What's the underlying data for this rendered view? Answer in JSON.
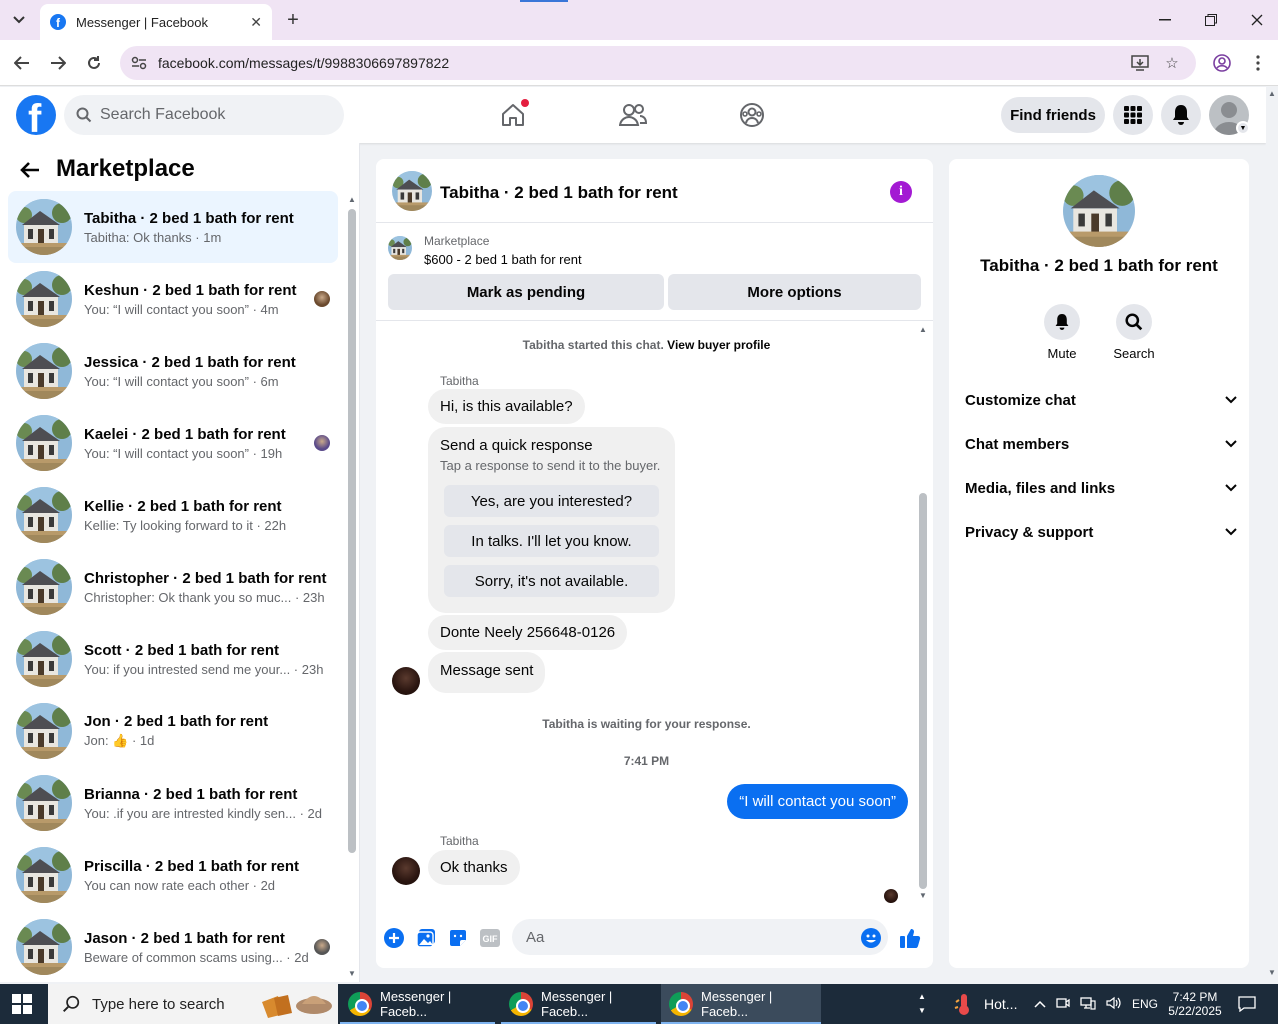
{
  "browser": {
    "tab_title": "Messenger | Facebook",
    "url": "facebook.com/messages/t/9988306697897822"
  },
  "fb": {
    "search_placeholder": "Search Facebook",
    "find_friends": "Find friends"
  },
  "sidebar": {
    "title": "Marketplace",
    "conversations": [
      {
        "name": "Tabitha · 2 bed 1 bath for rent",
        "snippet": "Tabitha: Ok thanks · 1m",
        "active": true
      },
      {
        "name": "Keshun · 2 bed 1 bath for rent",
        "snippet": "You: “I will contact you soon” · 4m"
      },
      {
        "name": "Jessica · 2 bed 1 bath for rent",
        "snippet": "You: “I will contact you soon” · 6m"
      },
      {
        "name": "Kaelei · 2 bed 1 bath for rent",
        "snippet": "You: “I will contact you soon” · 19h"
      },
      {
        "name": "Kellie · 2 bed 1 bath for rent",
        "snippet": "Kellie: Ty looking forward to it · 22h"
      },
      {
        "name": "Christopher · 2 bed 1 bath for rent",
        "snippet": "Christopher: Ok thank you so muc... · 23h"
      },
      {
        "name": "Scott · 2 bed 1 bath for rent",
        "snippet": "You: if you intrested send me your... · 23h"
      },
      {
        "name": "Jon · 2 bed 1 bath for rent",
        "snippet": "Jon: 👍 · 1d"
      },
      {
        "name": "Brianna · 2 bed 1 bath for rent",
        "snippet": "You: .if you are intrested kindly sen... · 2d"
      },
      {
        "name": "Priscilla · 2 bed 1 bath for rent",
        "snippet": "You can now rate each other · 2d"
      },
      {
        "name": "Jason · 2 bed 1 bath for rent",
        "snippet": "Beware of common scams using... · 2d"
      }
    ]
  },
  "chat": {
    "title": "Tabitha · 2 bed 1 bath for rent",
    "listing_source": "Marketplace",
    "listing_price": "$600 - 2 bed 1 bath for rent",
    "mark_pending": "Mark as pending",
    "more_options": "More options",
    "started": "Tabitha started this chat.",
    "view_profile": "View buyer profile",
    "sender_1": "Tabitha",
    "msg_1": "Hi, is this available?",
    "quick_title": "Send a quick response",
    "quick_sub": "Tap a response to send it to the buyer.",
    "quick_options": [
      "Yes, are you interested?",
      "In talks. I'll let you know.",
      "Sorry, it's not available."
    ],
    "msg_2": "Donte Neely 256648-0126",
    "msg_3": "Message sent",
    "waiting": "Tabitha is waiting for your response.",
    "time": "7:41 PM",
    "msg_out": "“I will contact you soon”",
    "sender_2": "Tabitha",
    "msg_4": "Ok thanks",
    "composer_placeholder": "Aa"
  },
  "info": {
    "name": "Tabitha · 2 bed 1 bath for rent",
    "mute": "Mute",
    "search": "Search",
    "rows": [
      "Customize chat",
      "Chat members",
      "Media, files and links",
      "Privacy & support"
    ]
  },
  "taskbar": {
    "search_placeholder": "Type here to search",
    "apps": [
      "Messenger | Faceb...",
      "Messenger | Faceb...",
      "Messenger | Faceb..."
    ],
    "weather": "Hot...",
    "lang": "ENG",
    "time": "7:42 PM",
    "date": "5/22/2025"
  }
}
